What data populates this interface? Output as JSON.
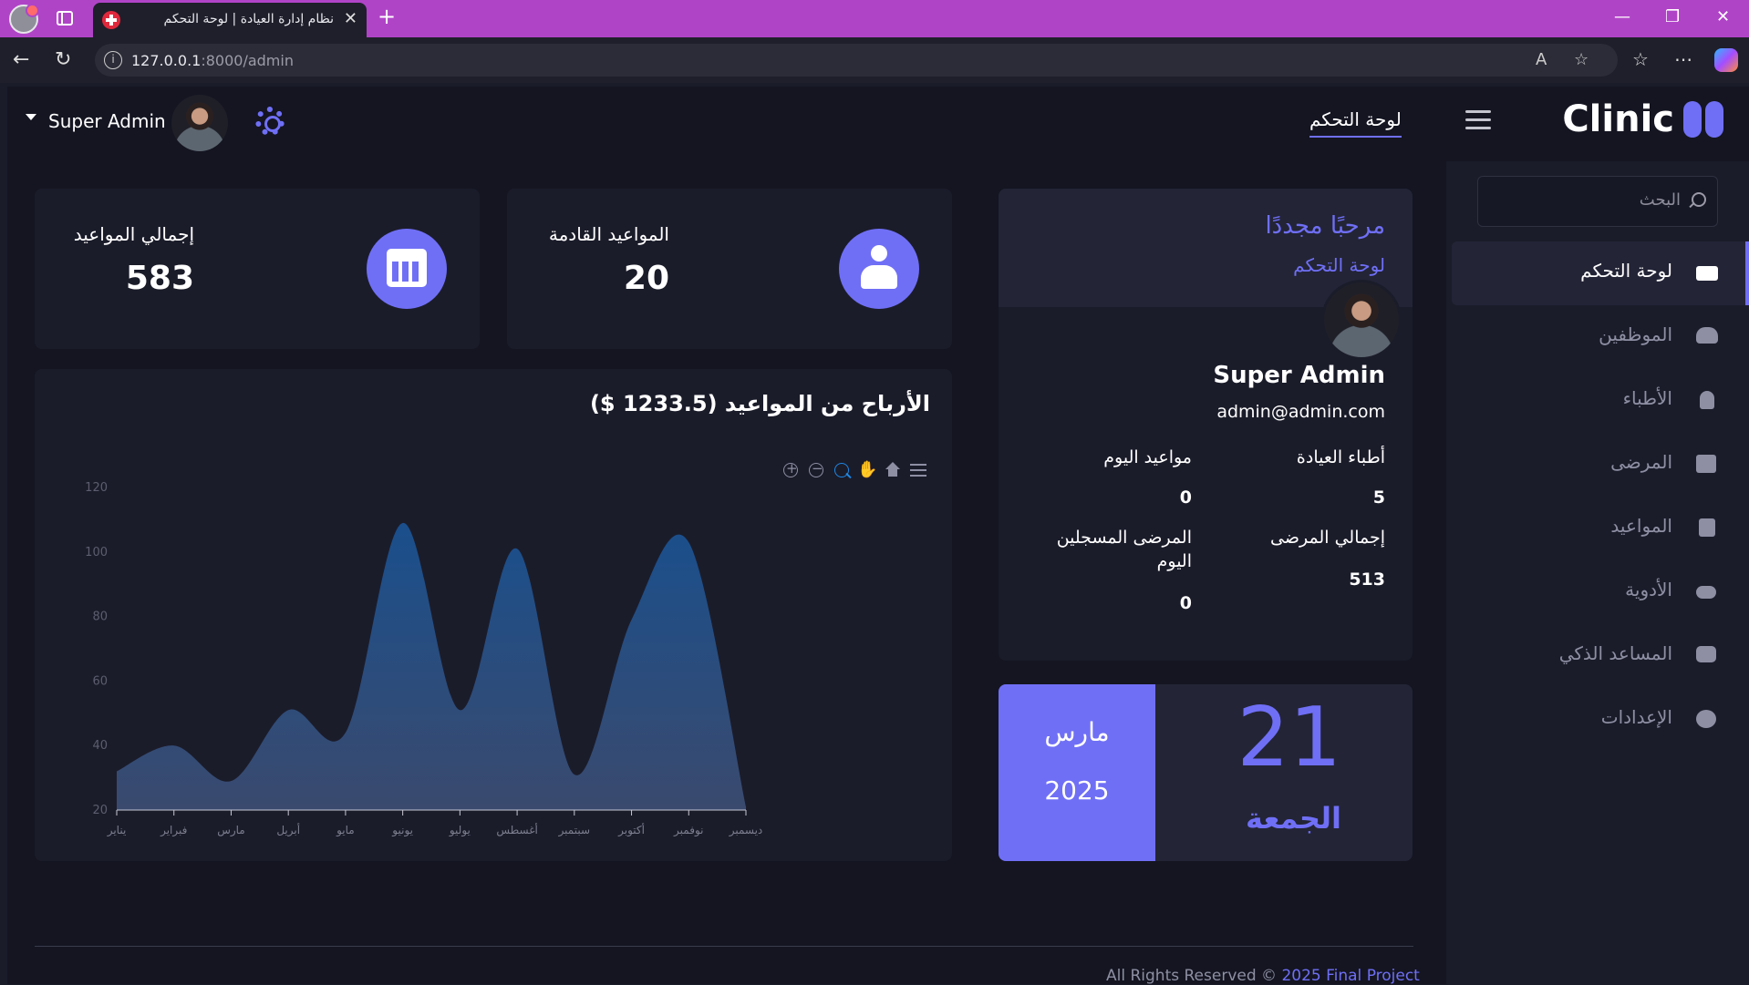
{
  "browser": {
    "tab_title": "نظام إدارة العيادة | لوحة التحكم",
    "url_host": "127.0.0.1",
    "url_path": ":8000/admin"
  },
  "topnav": {
    "brand": "Clinic",
    "nav_link": "لوحة التحكم",
    "user_name": "Super Admin"
  },
  "sidebar": {
    "search_placeholder": "البحث",
    "items": [
      {
        "label": "لوحة التحكم",
        "icon": "dashboard-icon",
        "active": true
      },
      {
        "label": "الموظفين",
        "icon": "users-icon",
        "active": false
      },
      {
        "label": "الأطباء",
        "icon": "doctor-icon",
        "active": false
      },
      {
        "label": "المرضى",
        "icon": "patient-icon",
        "active": false
      },
      {
        "label": "المواعيد",
        "icon": "calendar-icon",
        "active": false
      },
      {
        "label": "الأدوية",
        "icon": "pills-icon",
        "active": false
      },
      {
        "label": "المساعد الذكي",
        "icon": "robot-icon",
        "active": false
      },
      {
        "label": "الإعدادات",
        "icon": "gears-icon",
        "active": false
      }
    ]
  },
  "stats": {
    "total_label": "إجمالي المواعيد",
    "total_value": "583",
    "upcoming_label": "المواعيد القادمة",
    "upcoming_value": "20"
  },
  "welcome": {
    "title": "مرحبًا مجددًا",
    "subtitle": "لوحة التحكم",
    "name": "Super Admin",
    "email": "admin@admin.com",
    "doctors_label": "أطباء العيادة",
    "doctors_value": "5",
    "today_appts_label": "مواعيد اليوم",
    "today_appts_value": "0",
    "total_patients_label": "إجمالي المرضى",
    "total_patients_value": "513",
    "today_patients_label_1": "المرضى المسجلين",
    "today_patients_label_2": "اليوم",
    "today_patients_value": "0"
  },
  "date_card": {
    "month": "مارس",
    "year": "2025",
    "day": "21",
    "weekday": "الجمعة"
  },
  "chart_title": "الأرباح من المواعيد (1233.5 $)",
  "chart_data": {
    "type": "area",
    "title": "الأرباح من المواعيد (1233.5 $)",
    "categories": [
      "يناير",
      "فبراير",
      "مارس",
      "أبريل",
      "مايو",
      "يونيو",
      "يوليو",
      "أغسطس",
      "سبتمبر",
      "أكتوبر",
      "نوفمبر",
      "ديسمبر"
    ],
    "values": [
      32,
      40,
      29,
      51,
      44,
      109,
      51,
      101,
      31,
      79,
      103,
      21
    ],
    "ylim": [
      20,
      120
    ],
    "yticks": [
      20,
      40,
      60,
      80,
      100,
      120
    ],
    "colors": {
      "top": "#1a4f8c",
      "bottom": "#3a4a6e"
    },
    "grid": false,
    "xlabel": "",
    "ylabel": ""
  },
  "footer": {
    "text": "All Rights Reserved © ",
    "link": "2025 Final Project"
  }
}
